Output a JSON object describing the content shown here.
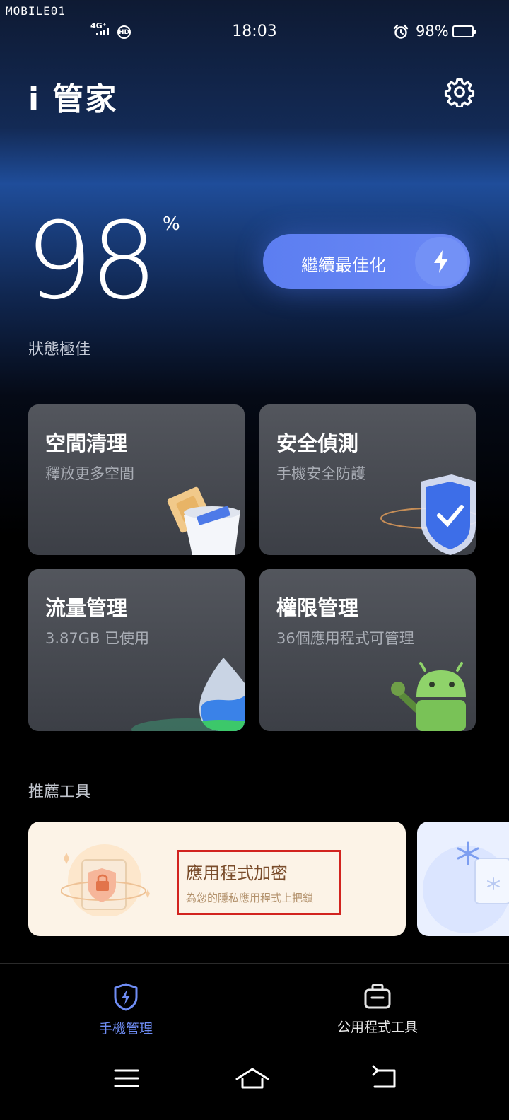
{
  "watermark": "MOBILE01",
  "status_bar": {
    "network": "4G⁺",
    "hd_label": "HD",
    "time": "18:03",
    "alarm_icon": "alarm-clock-icon",
    "battery_percent": "98%",
    "battery_level": 0.98,
    "battery_color": "#f2c200"
  },
  "header": {
    "title": "i 管家",
    "settings_icon": "gear-icon"
  },
  "score": {
    "value": "98",
    "unit": "%",
    "status": "狀態極佳"
  },
  "optimize_button": {
    "label": "繼續最佳化",
    "icon": "lightning-bolt-icon",
    "color": "#6b88f5"
  },
  "cards": [
    {
      "title": "空間清理",
      "subtitle": "釋放更多空間",
      "icon": "trash-bin-icon"
    },
    {
      "title": "安全偵測",
      "subtitle": "手機安全防護",
      "icon": "security-shield-icon"
    },
    {
      "title": "流量管理",
      "subtitle": "3.87GB 已使用",
      "icon": "water-drop-icon"
    },
    {
      "title": "權限管理",
      "subtitle": "36個應用程式可管理",
      "icon": "android-robot-icon"
    }
  ],
  "recommended": {
    "section_title": "推薦工具",
    "tools": [
      {
        "title": "應用程式加密",
        "subtitle": "為您的隱私應用程式上把鎖",
        "icon": "lock-shield-icon",
        "background": "#fcf3e7"
      },
      {
        "icon": "snowflake-icon",
        "background": "#eaf0ff"
      }
    ]
  },
  "bottom_nav": {
    "tabs": [
      {
        "label": "手機管理",
        "icon": "shield-bolt-icon",
        "active": true,
        "color": "#6f8df4"
      },
      {
        "label": "公用程式工具",
        "icon": "toolbox-icon",
        "active": false,
        "color": "#e6e6e6"
      }
    ]
  },
  "system_nav": [
    "menu-icon",
    "home-icon",
    "back-icon"
  ]
}
